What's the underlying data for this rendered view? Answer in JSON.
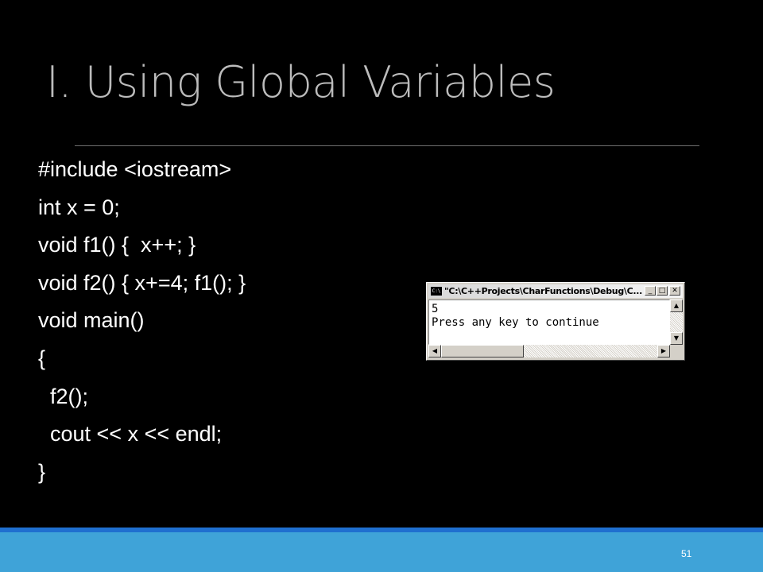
{
  "slide": {
    "title": "I. Using Global Variables",
    "code_lines": [
      "#include <iostream>",
      "int x = 0;",
      "void f1() {  x++; }",
      "void f2() { x+=4; f1(); }",
      "void main()",
      "{",
      "  f2();",
      "  cout << x << endl;",
      "}"
    ],
    "page_number": "51"
  },
  "console_window": {
    "icon_text": "C:\\",
    "title": "\"C:\\C++Projects\\CharFunctions\\Debug\\C...",
    "buttons": {
      "minimize": "_",
      "maximize": "□",
      "close": "✕"
    },
    "output_lines": [
      "5",
      "Press any key to continue"
    ],
    "scroll_arrows": {
      "up": "▲",
      "down": "▼",
      "left": "◀",
      "right": "▶"
    }
  },
  "colors": {
    "background": "#000000",
    "title_text": "#bcbcbc",
    "code_text": "#ffffff",
    "footer_band": "#3fa3d8",
    "footer_accent": "#1f6fd0"
  }
}
